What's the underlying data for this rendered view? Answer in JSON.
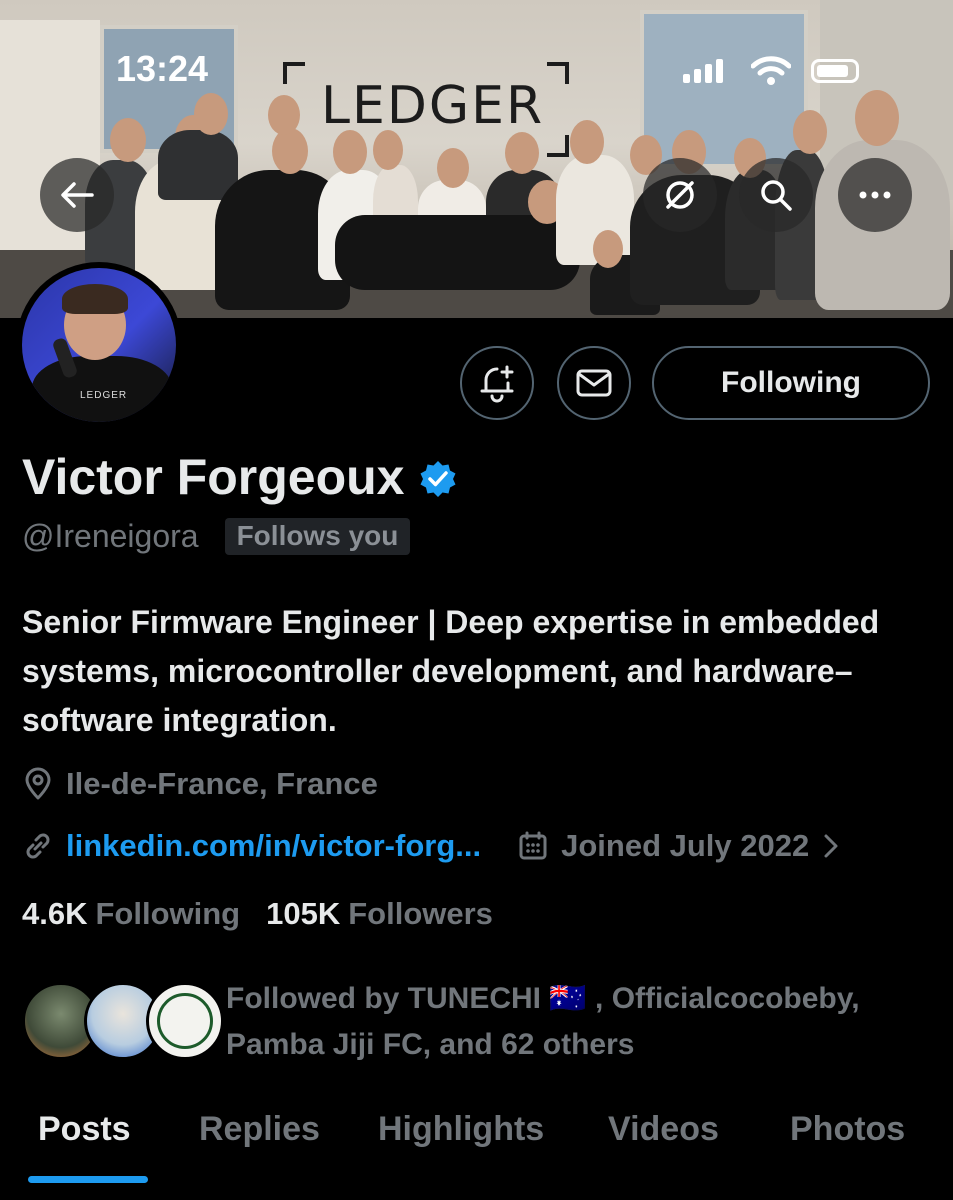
{
  "status_bar": {
    "time": "13:24"
  },
  "banner": {
    "logo_text": "LEDGER"
  },
  "profile": {
    "display_name": "Victor Forgeoux",
    "handle": "@Ireneigora",
    "follows_you_badge": "Follows you",
    "bio": "Senior Firmware Engineer | Deep expertise in embedded systems, microcontroller development, and hardware–software integration.",
    "location": "Ile-de-France, France",
    "website": "linkedin.com/in/victor-forg...",
    "joined": "Joined July 2022",
    "avatar_logo_text": "LEDGER",
    "verified_color": "#1d9bf0"
  },
  "actions": {
    "following_label": "Following"
  },
  "stats": {
    "following_count": "4.6K",
    "following_label": "Following",
    "followers_count": "105K",
    "followers_label": "Followers"
  },
  "followed_by": {
    "text": "Followed by TUNECHI 🇦🇺 , Officialcocobeby, Pamba Jiji FC, and 62 others"
  },
  "tabs": [
    {
      "label": "Posts",
      "active": true
    },
    {
      "label": "Replies",
      "active": false
    },
    {
      "label": "Highlights",
      "active": false
    },
    {
      "label": "Videos",
      "active": false
    },
    {
      "label": "Photos",
      "active": false
    }
  ],
  "icons": {
    "back": "arrow-left-icon",
    "hide": "eye-slash-icon",
    "search": "search-icon",
    "more": "more-icon",
    "notify": "bell-plus-icon",
    "message": "envelope-icon",
    "location": "location-pin-icon",
    "link": "link-icon",
    "calendar": "calendar-icon",
    "chevron": "chevron-right-icon",
    "verified": "verified-badge-icon"
  },
  "colors": {
    "background": "#000000",
    "text_primary": "#e7e9ea",
    "text_secondary": "#71767b",
    "accent": "#1d9bf0",
    "border": "#536471"
  }
}
